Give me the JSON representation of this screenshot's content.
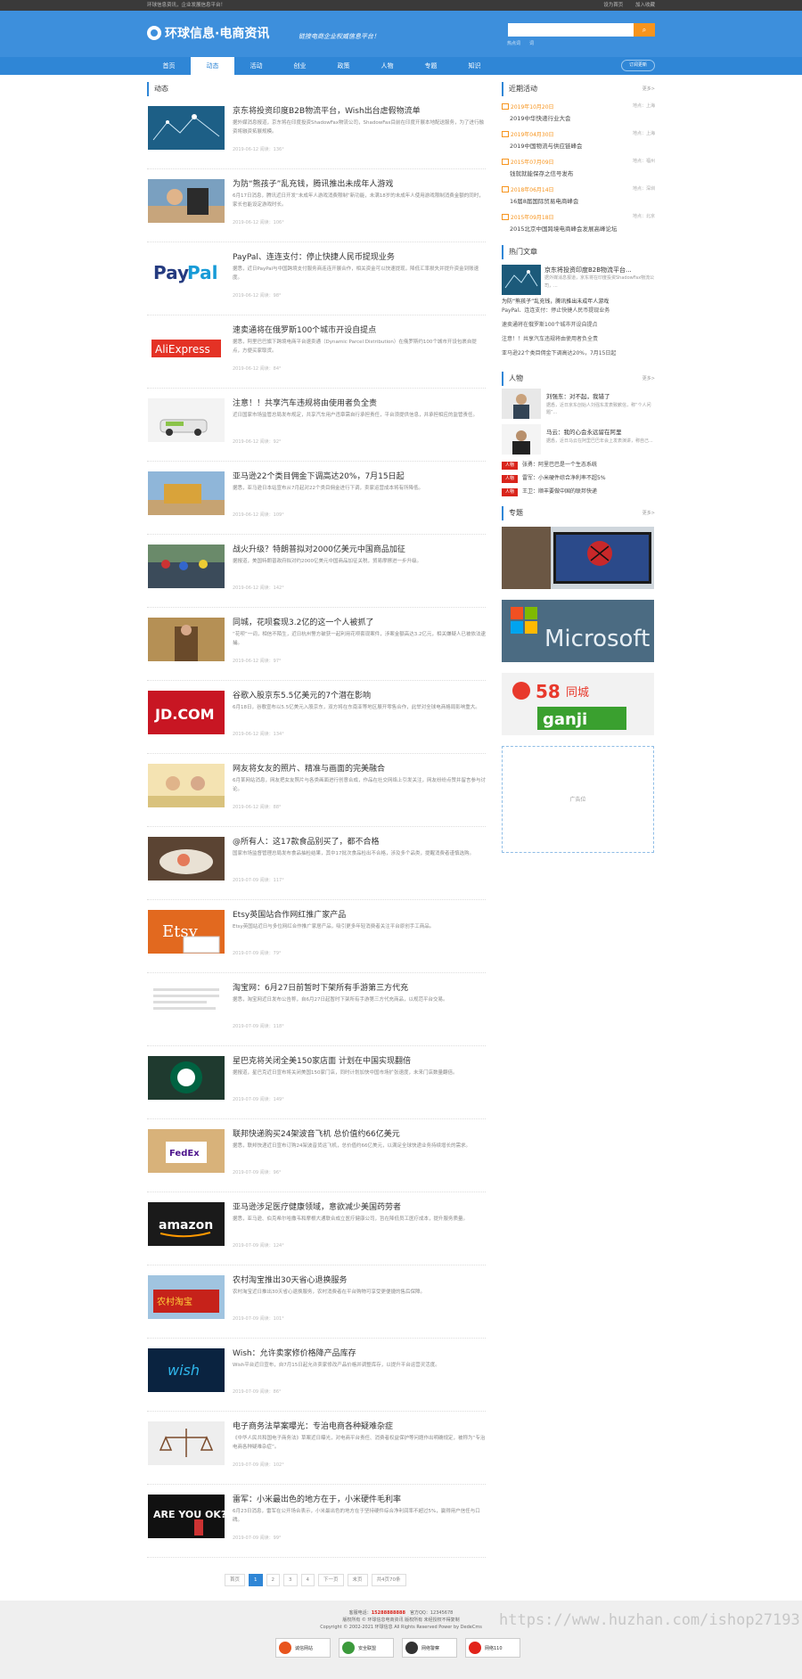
{
  "topbar": {
    "left": "环球信息资讯，企业发展信息平台！",
    "right": [
      "设为首页",
      "加入收藏"
    ]
  },
  "header": {
    "logo": "环球信息·电商资讯",
    "slogan": "链接电商企业权威信息平台！",
    "search_placeholder": "",
    "hot_words": [
      "热点词",
      "词"
    ]
  },
  "nav": {
    "items": [
      "首页",
      "动态",
      "活动",
      "创业",
      "政策",
      "人物",
      "专题",
      "知识"
    ],
    "active": 1,
    "subscribe": "订阅更新"
  },
  "main": {
    "section_title": "动态",
    "articles": [
      {
        "title": "京东将投资印度B2B物流平台，Wish出台虐假物流单",
        "desc": "据外媒消息报道，京东将在印度投资ShadowFax物流公司，ShadowFax目前在印度开展本地配送服务，为了进行融资将融资拓展规模。",
        "date": "2019-06-12 阅读：136°"
      },
      {
        "title": "为防“熊孩子”乱充钱，腾讯推出未成年人游戏",
        "desc": "6月17日消息，腾讯近日开发“未成年人游戏消费限制”新功能，未满18岁的未成年人使用游戏限制消费金额的同时，家长也能设定游戏时长。",
        "date": "2019-06-12 阅读：106°"
      },
      {
        "title": "PayPal、连连支付：停止快捷人民币提现业务",
        "desc": "据悉，近日PayPal与中国跨境支付服务商连连开展合作，相关资金可以快速提现，降低汇率损失并提升资金到账速度。",
        "date": "2019-06-12 阅读：98°"
      },
      {
        "title": "速卖通将在俄罗斯100个城市开设自提点",
        "desc": "据悉，阿里巴巴旗下跨境电商平台速卖通（Dynamic Parcel Distribution）在俄罗斯约100个城市开设包裹自提点，方便买家取货。",
        "date": "2019-06-12 阅读：84°"
      },
      {
        "title": "注意！！共享汽车违规将由使用者负全责",
        "desc": "近日国家市场监管总局发布规定，共享汽车用户违章需自行承担责任，平台须提供信息，并承担相应的监管责任。",
        "date": "2019-06-12 阅读：92°"
      },
      {
        "title": "亚马逊22个类目佣金下调高达20%，7月15日起",
        "desc": "据悉，亚马逊日本站宣布从7月起对22个类目佣金进行下调，卖家运营成本将有所降低。",
        "date": "2019-06-12 阅读：109°"
      },
      {
        "title": "战火升级？特朗普拟对2000亿美元中国商品加征",
        "desc": "据报道，美国特朗普政府拟对约2000亿美元中国商品加征关税，贸易摩擦进一步升级。",
        "date": "2019-06-12 阅读：142°"
      },
      {
        "title": "同城，花呗套现3.2亿的这一个人被抓了",
        "desc": "“花呗”一词，相信不陌生，近日杭州警方破获一起利用花呗套现案件，涉案金额高达3.2亿元，相关嫌疑人已被依法逮捕。",
        "date": "2019-06-12 阅读：97°"
      },
      {
        "title": "谷歌入股京东5.5亿美元的7个潜在影响",
        "desc": "6月18日，谷歌宣布以5.5亿美元入股京东，双方将在东南亚等地区展开零售合作，此举对全球电商格局影响重大。",
        "date": "2019-06-12 阅读：134°"
      },
      {
        "title": "网友将女友的照片、精准与画面的完美融合",
        "desc": "6月某网站消息，网友把女友照片与各类画面进行创意合成，作品在社交网络上引发关注，网友纷纷点赞并留言参与讨论。",
        "date": "2019-06-12 阅读：88°"
      },
      {
        "title": "@所有人：这17款食品别买了，都不合格",
        "desc": "国家市场监督管理总局发布食品抽检结果，其中17批次食品检出不合格，涉及多个品类，提醒消费者谨慎选购。",
        "date": "2019-07-09 阅读：117°"
      },
      {
        "title": "Etsy英国站合作网红推广家产品",
        "desc": "Etsy英国站近日与多位网红合作推广家居产品，吸引更多年轻消费者关注平台原创手工商品。",
        "date": "2019-07-09 阅读：79°"
      },
      {
        "title": "淘宝网：6月27日前暂时下架所有手游第三方代充",
        "desc": "据悉，淘宝网近日发布公告称，自6月27日起暂时下架所有手游第三方代充商品，以规范平台交易。",
        "date": "2019-07-09 阅读：118°"
      },
      {
        "title": "星巴克将关闭全美150家店面 计划在中国实现翻倍",
        "desc": "据报道，星巴克近日宣布将关闭美国150家门店，同时计划加快中国市场扩张速度，未来门店数量翻倍。",
        "date": "2019-07-09 阅读：149°"
      },
      {
        "title": "联邦快递购买24架波音飞机 总价值约66亿美元",
        "desc": "据悉，联邦快递近日宣布订购24架波音货运飞机，总价值约66亿美元，以满足全球快递业务持续增长的需求。",
        "date": "2019-07-09 阅读：96°"
      },
      {
        "title": "亚马逊涉足医疗健康领域，意欲减少美国药劳者",
        "desc": "据悉，亚马逊、伯克希尔哈撒韦和摩根大通联合成立医疗健康公司，旨在降低员工医疗成本，提升服务质量。",
        "date": "2019-07-09 阅读：124°"
      },
      {
        "title": "农村淘宝推出30天省心退换服务",
        "desc": "农村淘宝近日推出30天省心退换服务，农村消费者在平台购物可享受更便捷的售后保障。",
        "date": "2019-07-09 阅读：101°"
      },
      {
        "title": "Wish：允许卖家修价格降产品库存",
        "desc": "Wish平台近日宣布，自7月15日起允许卖家修改产品价格并调整库存，以提升平台运营灵活度。",
        "date": "2019-07-09 阅读：86°"
      },
      {
        "title": "电子商务法草案曝光：专治电商各种疑难杂症",
        "desc": "《中华人民共和国电子商务法》草案近日曝光，对电商平台责任、消费者权益保护等问题作出明确规定，被称为“专治电商各种疑难杂症”。",
        "date": "2019-07-09 阅读：102°"
      },
      {
        "title": "雷军：小米最出色的地方在于，小米硬件毛利率",
        "desc": "6月23日消息，雷军在公开场合表示，小米最出色的地方在于坚持硬件综合净利润率不超过5%，赢得用户信任与口碑。",
        "date": "2019-07-09 阅读：99°"
      }
    ],
    "pager": [
      "首页",
      "1",
      "2",
      "3",
      "4",
      "下一页",
      "末页",
      "共4页70条"
    ]
  },
  "side": {
    "activity_title": "近期活动",
    "more": "更多>",
    "activities": [
      {
        "date": "2019年10月20日",
        "loc": "地点：上海",
        "name": "2019中华快递行业大会"
      },
      {
        "date": "2019年04月30日",
        "loc": "地点：上海",
        "name": "2019中国物流与供应链峰会"
      },
      {
        "date": "2015年07月09日",
        "loc": "地点：福州",
        "name": "钱就就能保存之信号发布"
      },
      {
        "date": "2018年06月14日",
        "loc": "地点：深圳",
        "name": "16届8届国际贸易电商峰会"
      },
      {
        "date": "2015年09月18日",
        "loc": "地点：北京",
        "name": "2015北京中国跨境电商峰会发展高峰论坛"
      }
    ],
    "hot_title": "热门文章",
    "hot_first": {
      "title": "京东将投资印度B2B物流平台...",
      "desc": "据外媒消息报道，京东将在印度投资ShadowFax物流公司，...",
      "line": "为防“熊孩子”乱充钱，腾讯推出未成年人游戏"
    },
    "hot_list": [
      "PayPal、连连支付：停止快捷人民币提现业务",
      "速卖通将在俄罗斯100个城市开设自提点",
      "注意！！共享汽车违规将由使用者负全责",
      "亚马逊22个类目佣金下调高达20%，7月15日起"
    ],
    "people_title": "人物",
    "people": [
      {
        "name": "刘强东：对不起，我错了",
        "desc": "据悉，近日京东创始人刘强东发表致歉信，称“个人问题”..."
      },
      {
        "name": "马云：我的心会永远留在阿里",
        "desc": "据悉，近日马云在阿里巴巴年会上发表演讲，称自己..."
      }
    ],
    "people_list": [
      "张勇：阿里巴巴是一个生态系统",
      "雷军：小米硬件综合净利率不超5%",
      "王卫：顺丰要做中国的联邦快递"
    ],
    "people_tag": "人物",
    "topic_title": "专题",
    "topics": [
      "surface",
      "microsoft",
      "58同城"
    ],
    "ad": "广告位"
  },
  "footer": {
    "line1_a": "客服电话：",
    "phone": "15288888888",
    "line1_b": "官方QQ：",
    "qq": "12345678",
    "line2": "版权所有 © 环球信息电商资讯 版权所有 未经授权不得复制",
    "line3": "Copyright © 2002-2021 环球信息 All Rights Reserved Power by DedeCms",
    "badges": [
      "诚信网站",
      "安全联盟",
      "网络警察",
      "网络110"
    ]
  },
  "watermark": "https://www.huzhan.com/ishop27193",
  "colors": {
    "accent": "#2f86d6",
    "orange": "#f7941d",
    "red": "#d9241b"
  }
}
